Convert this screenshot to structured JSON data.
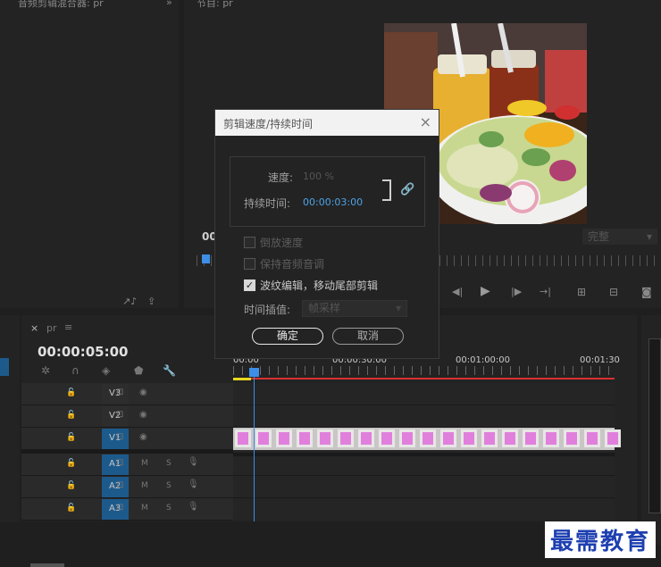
{
  "source_panel": {
    "title": "音频剪辑混合器: pr"
  },
  "program_panel": {
    "title": "节目: pr",
    "timecode": "00",
    "quality": "完整"
  },
  "timeline": {
    "tab": "pr",
    "timecode": "00:00:05:00",
    "ruler": [
      "00:00",
      "00:00:30:00",
      "00:01:00:00",
      "00:01:30"
    ],
    "video_tracks": [
      {
        "name": "V3",
        "targeted": false
      },
      {
        "name": "V2",
        "targeted": false
      },
      {
        "name": "V1",
        "targeted": true
      }
    ],
    "audio_tracks": [
      {
        "name": "A1",
        "m": "M",
        "s": "S"
      },
      {
        "name": "A2",
        "m": "M",
        "s": "S"
      },
      {
        "name": "A3",
        "m": "M",
        "s": "S"
      }
    ]
  },
  "dialog": {
    "title": "剪辑速度/持续时间",
    "speed_label": "速度:",
    "speed_value": "100 %",
    "duration_label": "持续时间:",
    "duration_value": "00:00:03:00",
    "reverse_label": "倒放速度",
    "reverse_checked": false,
    "keep_pitch_label": "保持音频音调",
    "keep_pitch_checked": false,
    "ripple_label": "波纹编辑，移动尾部剪辑",
    "ripple_checked": true,
    "interp_label": "时间插值:",
    "interp_value": "帧采样",
    "ok_label": "确定",
    "cancel_label": "取消"
  },
  "watermark": "最需教育",
  "colors": {
    "accent_blue": "#1d5a8c",
    "timecode_blue": "#4da3e6",
    "playhead": "#3c8ee6",
    "clip_frame": "#e080dc",
    "work_bar_red": "#d83030"
  }
}
